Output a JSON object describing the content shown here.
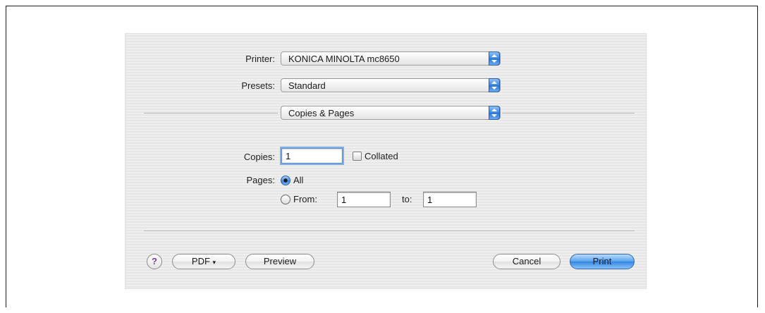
{
  "printer": {
    "label": "Printer:",
    "value": "KONICA MINOLTA mc8650"
  },
  "presets": {
    "label": "Presets:",
    "value": "Standard"
  },
  "panel": {
    "value": "Copies & Pages"
  },
  "copies": {
    "label": "Copies:",
    "value": "1",
    "collated_label": "Collated",
    "collated_checked": false
  },
  "pages": {
    "label": "Pages:",
    "all_label": "All",
    "all_selected": true,
    "from_label": "From:",
    "from_value": "1",
    "to_label": "to:",
    "to_value": "1"
  },
  "buttons": {
    "help": "?",
    "pdf": "PDF",
    "pdf_caret": "▾",
    "preview": "Preview",
    "cancel": "Cancel",
    "print": "Print"
  },
  "icons": {
    "popup_arrows": "updown-arrows-icon",
    "pdf_caret": "chevron-down-icon",
    "help": "question-icon"
  },
  "colors": {
    "accent_blue": "#3b86e6",
    "help_purple": "#7a3fb0"
  }
}
